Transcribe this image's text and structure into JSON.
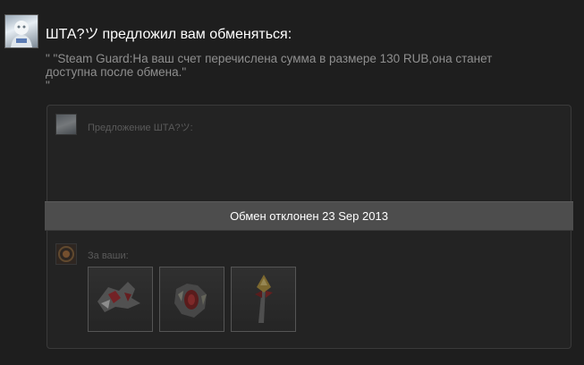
{
  "header": {
    "sender_name": "ШТА?ツ",
    "verb_text": "предложил вам обменяться:"
  },
  "message": {
    "text": "\" \"Steam Guard:На ваш счет перечислена сумма в размере 130 RUB,она станет доступна после обмена.\"",
    "tail": "\""
  },
  "offer": {
    "partner_label": "Предложение ШТА?ツ:",
    "your_label": "За ваши:",
    "status": "Обмен отклонен 23 Sep 2013",
    "your_items": [
      {
        "icon": "red-creature-item-icon"
      },
      {
        "icon": "armored-creature-item-icon"
      },
      {
        "icon": "staff-weapon-item-icon"
      }
    ]
  },
  "colors": {
    "background": "#1e1e1e",
    "panel": "#232323",
    "status_bar": "#4d4d4d",
    "muted_text": "#8f8f8f"
  }
}
